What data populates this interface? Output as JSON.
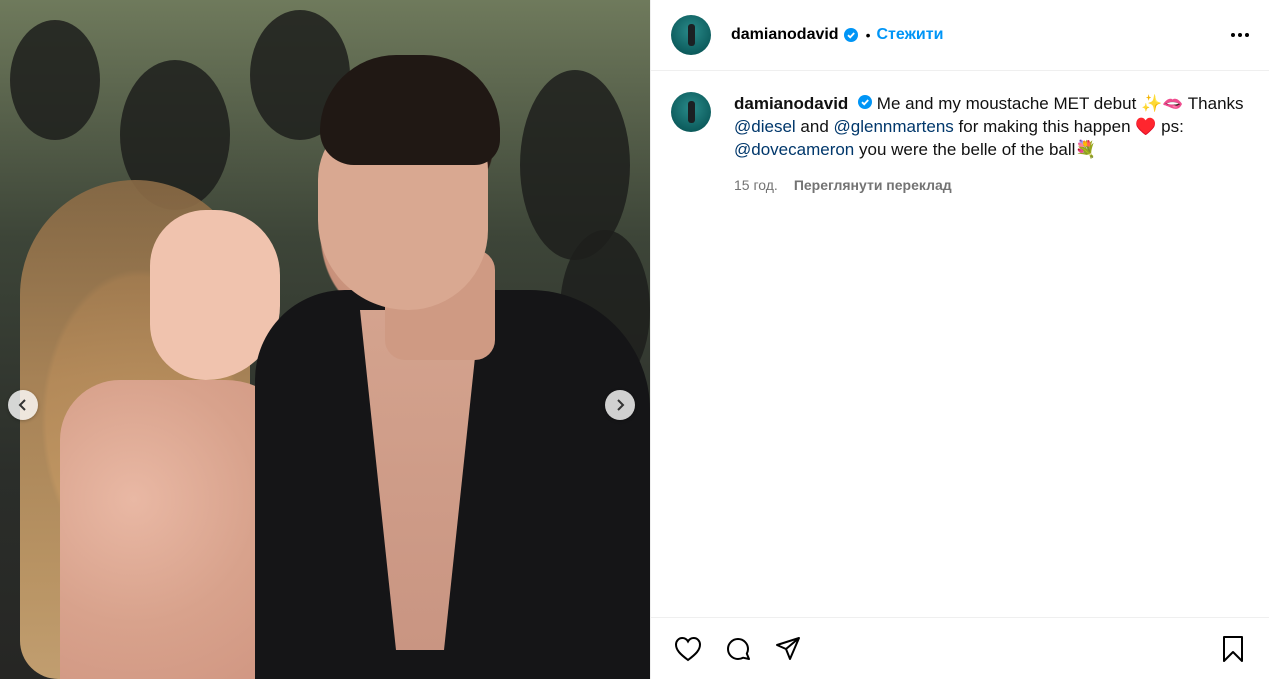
{
  "post": {
    "username": "damianodavid",
    "follow_label": "Стежити",
    "dot": "•"
  },
  "caption": {
    "username": "damianodavid",
    "text_1": "Me and my moustache MET debut ✨🫦 Thanks",
    "mention_diesel": "@diesel",
    "text_2": "and",
    "mention_glenn": "@glennmartens",
    "text_3": "for making this happen ♥️ ps:",
    "mention_dove": "@dovecameron",
    "text_4": "you were the belle of the ball💐",
    "time": "15 год.",
    "translate_label": "Переглянути переклад"
  },
  "icons": {
    "like": "heart-icon",
    "comment": "comment-icon",
    "share": "share-icon",
    "save": "bookmark-icon",
    "verified": "verified-badge-icon",
    "prev": "chevron-left-icon",
    "next": "chevron-right-icon"
  },
  "colors": {
    "follow": "#0095f6",
    "verified": "#0095f6",
    "mention": "#00376b",
    "meta": "#737373"
  }
}
